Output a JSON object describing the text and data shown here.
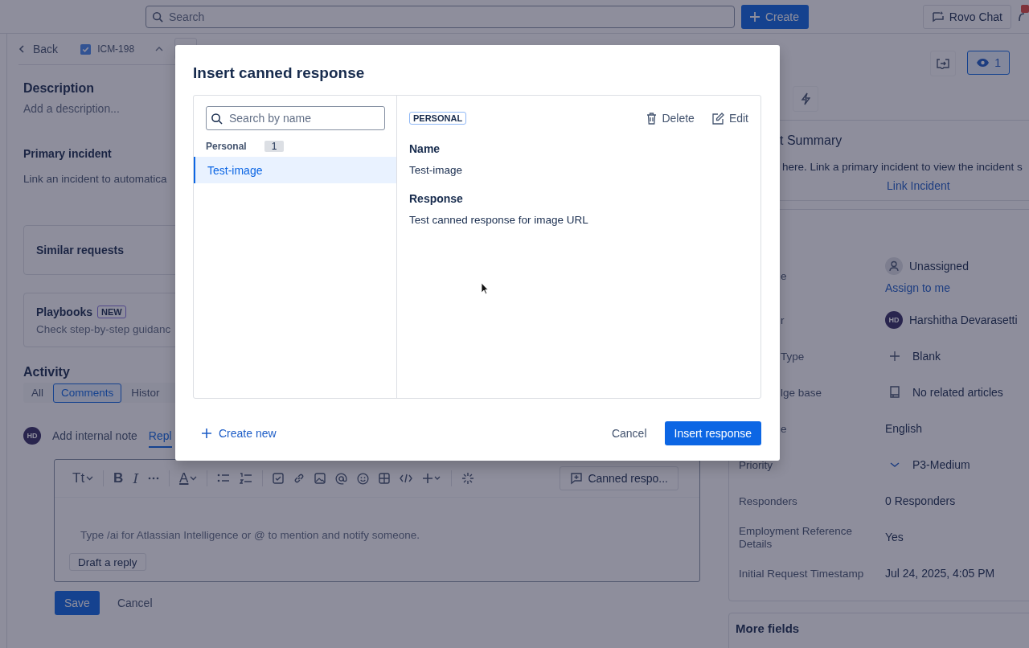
{
  "top_bar": {
    "search": {
      "placeholder": "Search"
    },
    "create_button": "Create",
    "rovo_button": "Rovo Chat"
  },
  "issue_header": {
    "back": "Back",
    "key": "ICM-198"
  },
  "description": {
    "heading": "Description",
    "placeholder": "Add a description..."
  },
  "primary_incident": {
    "heading": "Primary incident",
    "text": "Link an incident to automatica"
  },
  "cards": [
    {
      "kind": "plain",
      "title": "Similar requests"
    },
    {
      "kind": "badge",
      "title": "Playbooks",
      "badge": "NEW",
      "text": "Check step-by-step guidanc"
    }
  ],
  "activity": {
    "heading": "Activity",
    "tabs": [
      {
        "label": "All",
        "selected": false
      },
      {
        "label": "Comments",
        "selected": true
      },
      {
        "label": "Histor",
        "selected": false
      }
    ]
  },
  "comment_tabs": {
    "avatar": "HD",
    "tabs": [
      {
        "label": "Add internal note",
        "selected": false
      },
      {
        "label": "Repl",
        "selected": true
      }
    ]
  },
  "editor": {
    "format_label": "Tt",
    "bold_label": "B",
    "italic_label": "I",
    "color_label": "A",
    "canned_button": "Canned respo...",
    "placeholder": "Type /ai for Atlassian Intelligence or @ to mention and notify someone.",
    "draft_button": "Draft a reply"
  },
  "editor_actions": {
    "save": "Save",
    "cancel": "Cancel"
  },
  "watchers": {
    "count": "1"
  },
  "summary": {
    "heading": "t Summary",
    "text": "here. Link a primary incident to view the incident s",
    "link": "Link Incident"
  },
  "details": [
    {
      "kind": "assignee",
      "label": "e",
      "partial": true,
      "value": "Unassigned",
      "link": "Assign to me"
    },
    {
      "kind": "person",
      "label": "r",
      "partial": true,
      "value": "Harshitha Devarasetti",
      "initials": "HD"
    },
    {
      "kind": "add",
      "label": "Type",
      "partial": true,
      "value": "Blank"
    },
    {
      "kind": "article",
      "label": "lge base",
      "partial": true,
      "value": "No related articles"
    },
    {
      "kind": "text",
      "label": "e",
      "partial": true,
      "value": "English"
    },
    {
      "kind": "priority",
      "label": "Priority",
      "value": "P3-Medium"
    },
    {
      "kind": "text",
      "label": "Responders",
      "value": "0 Responders"
    },
    {
      "kind": "text",
      "label": "Employment Reference Details",
      "value": "Yes"
    },
    {
      "kind": "text",
      "label": "Initial Request Timestamp",
      "value": "Jul 24, 2025, 4:05 PM"
    }
  ],
  "more_fields": "More fields",
  "modal": {
    "title": "Insert canned response",
    "search": {
      "placeholder": "Search by name"
    },
    "group": {
      "label": "Personal",
      "count": "1"
    },
    "items": [
      {
        "label": "Test-image",
        "selected": true
      }
    ],
    "detail": {
      "badge": "PERSONAL",
      "delete": "Delete",
      "edit": "Edit",
      "name_label": "Name",
      "name": "Test-image",
      "response_label": "Response",
      "response": "Test canned response for image URL"
    },
    "create_new": "Create new",
    "cancel": "Cancel",
    "insert": "Insert response"
  }
}
